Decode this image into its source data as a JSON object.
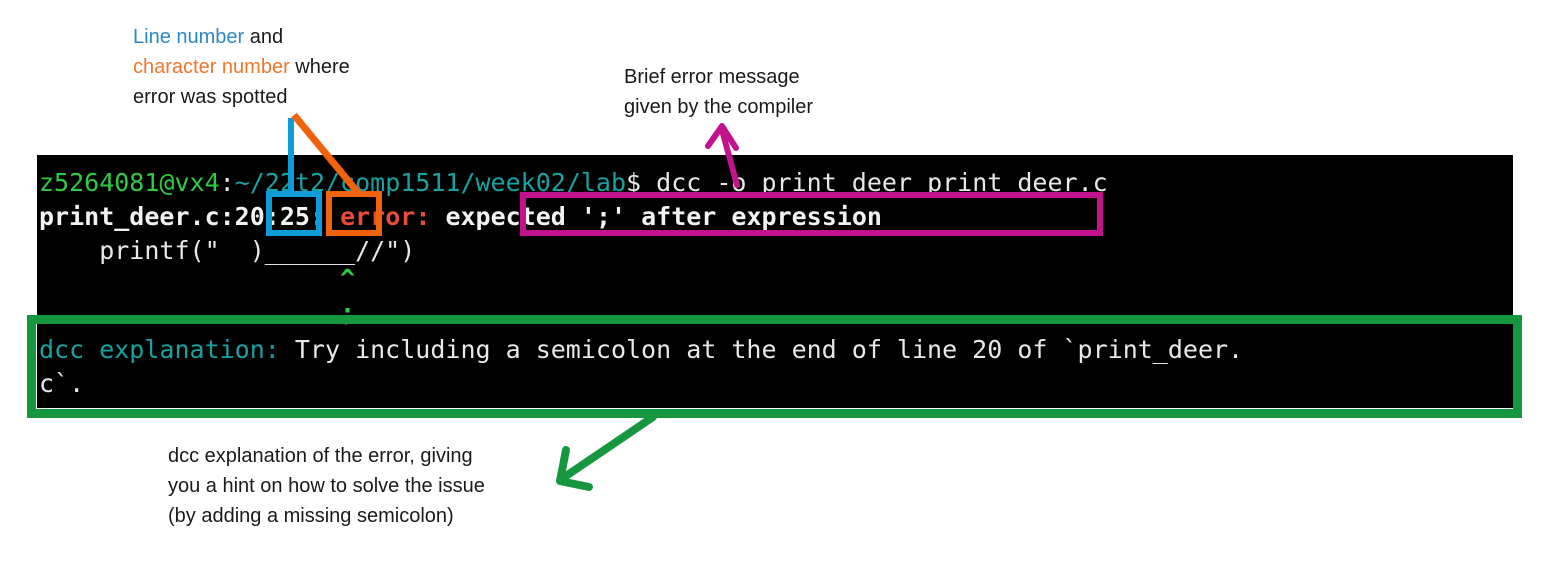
{
  "annotations": {
    "line_char": {
      "part1": "Line number",
      "part2": " and",
      "part3": "character number",
      "part4": " where",
      "part5": "error was spotted"
    },
    "brief_error": {
      "line1": "Brief error message",
      "line2": "given by the compiler"
    },
    "dcc_explanation": {
      "line1": "dcc explanation of the error, giving",
      "line2": "you a hint on how to solve the issue",
      "line3": "(by adding a missing semicolon)"
    }
  },
  "terminal": {
    "prompt": {
      "user_host": "z5264081@vx4",
      "separator": ":",
      "path": "~/22t2/comp1511/week02/lab",
      "dollar": "$",
      "command": " dcc -o print_deer print_deer.c"
    },
    "error_line": {
      "file": "print_deer.c:",
      "line_number": "20",
      "colon1": ":",
      "char_number": "25",
      "colon2": ":",
      "error_label": " error: ",
      "message": "expected ';' after expression"
    },
    "source_line": "    printf(\"  )______//\")",
    "caret_line": "                    ^",
    "semicolon_line": "                    ;",
    "explanation": {
      "label": "dcc explanation:",
      "text_line1": " Try including a semicolon at the end of line 20 of `print_deer.",
      "text_line2": "c`."
    }
  },
  "colors": {
    "line_number_highlight": "#0f9bd7",
    "char_number_highlight": "#f0620c",
    "error_message_highlight": "#c2128d",
    "explanation_highlight": "#16973f",
    "terminal_background": "#000000",
    "prompt_user": "#2ecc40",
    "prompt_path": "#17a2a2",
    "error_keyword": "#e74c3c"
  }
}
